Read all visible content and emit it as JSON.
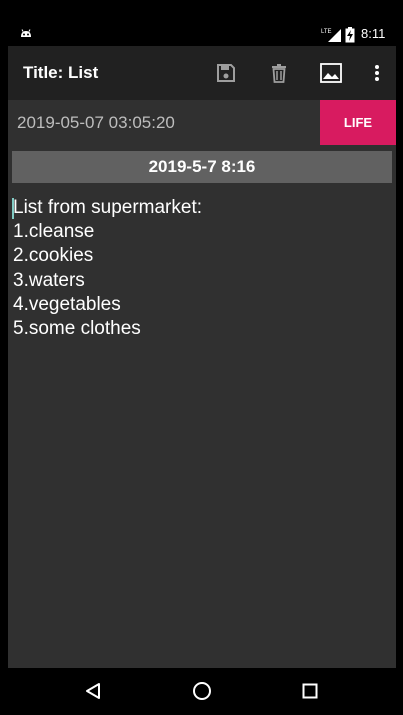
{
  "status_bar": {
    "network_label": "LTE",
    "time": "8:11"
  },
  "app_bar": {
    "title": "Title: List",
    "actions": [
      "save-icon",
      "delete-icon",
      "image-icon",
      "more-vert-icon"
    ]
  },
  "note": {
    "created_at": "2019-05-07 03:05:20",
    "category": "LIFE",
    "date_header": "2019-5-7 8:16",
    "lines": [
      "List from supermarket:",
      "1.cleanse",
      "2.cookies",
      "3.waters",
      "4.vegetables",
      "5.some clothes"
    ]
  },
  "nav_bar": {
    "buttons": [
      "back-icon",
      "home-icon",
      "recents-icon"
    ]
  },
  "colors": {
    "accent": "#d81b60",
    "app_bar": "#212121",
    "content_bg": "#303030",
    "date_header_bg": "#616161"
  }
}
